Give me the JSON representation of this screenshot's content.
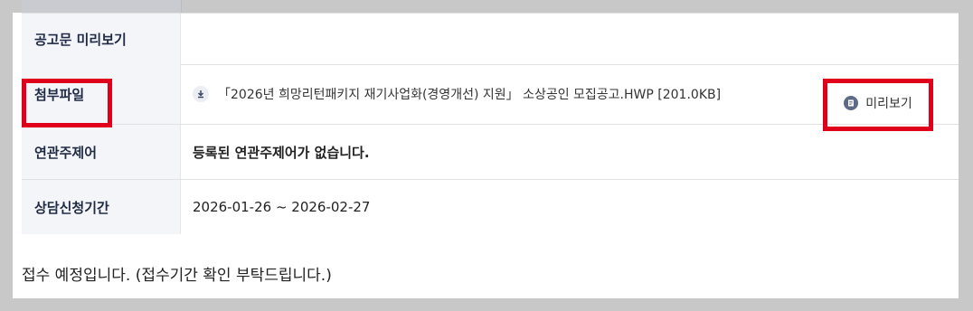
{
  "table": {
    "rows": [
      {
        "label": "공고문 미리보기",
        "value": ""
      },
      {
        "label": "첨부파일",
        "value": "「2026년 희망리턴패키지 재기사업화(경영개선) 지원」 소상공인 모집공고.HWP [201.0KB]"
      },
      {
        "label": "연관주제어",
        "value": "등록된 연관주제어가 없습니다."
      },
      {
        "label": "상담신청기간",
        "value": "2026-01-26 ~ 2026-02-27"
      }
    ],
    "preview_button": "미리보기"
  },
  "note": "접수 예정입니다. (접수기간 확인 부탁드립니다.)",
  "colors": {
    "highlight": "#e0001b",
    "label_bg": "#f4f5f9",
    "label_text": "#1f2a44"
  }
}
